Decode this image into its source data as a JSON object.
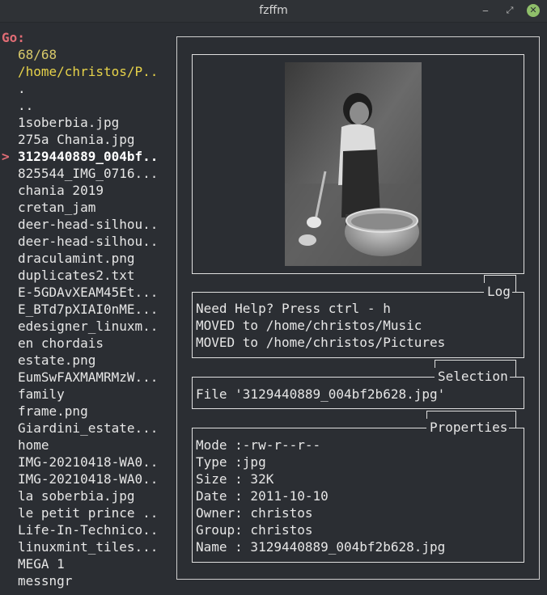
{
  "window": {
    "title": "fzffm"
  },
  "window_controls": {
    "minimize": "‒",
    "maximize": "⤢",
    "close": "✕"
  },
  "prompt": "Go:",
  "counter": "68/68",
  "current_path": "/home/christos/P..",
  "cursor_marker": ">",
  "files": [
    ".",
    "..",
    "1soberbia.jpg",
    "275a Chania.jpg",
    "3129440889_004bf..",
    "825544_IMG_0716...",
    "chania 2019",
    "cretan_jam",
    "deer-head-silhou..",
    "deer-head-silhou..",
    "draculamint.png",
    "duplicates2.txt",
    "E-5GDAvXEAM45Et...",
    "E_BTd7pXIAI0nME...",
    "edesigner_linuxm..",
    "en chordais",
    "estate.png",
    "EumSwFAXMAMRMzW...",
    "family",
    "frame.png",
    "Giardini_estate...",
    "home",
    "IMG-20210418-WA0..",
    "IMG-20210418-WA0..",
    "la soberbia.jpg",
    "le petit prince ..",
    "Life-In-Technico..",
    "linuxmint_tiles...",
    "MEGA 1",
    "messngr"
  ],
  "selected_index": 4,
  "log": {
    "label": "Log",
    "lines": [
      "Need Help? Press ctrl - h",
      "MOVED to /home/christos/Music",
      "MOVED to /home/christos/Pictures"
    ]
  },
  "selection": {
    "label": "Selection",
    "text": "File '3129440889_004bf2b628.jpg'"
  },
  "properties": {
    "label": "Properties",
    "lines": [
      "Mode :-rw-r--r--",
      "Type :jpg",
      "Size : 32K",
      "Date : 2011-10-10",
      "Owner: christos",
      "Group: christos",
      "Name : 3129440889_004bf2b628.jpg"
    ]
  },
  "colors": {
    "background": "#2b2e33",
    "prompt": "#e06c75",
    "path": "#e6d24a",
    "close_button": "#8fbf6a"
  }
}
